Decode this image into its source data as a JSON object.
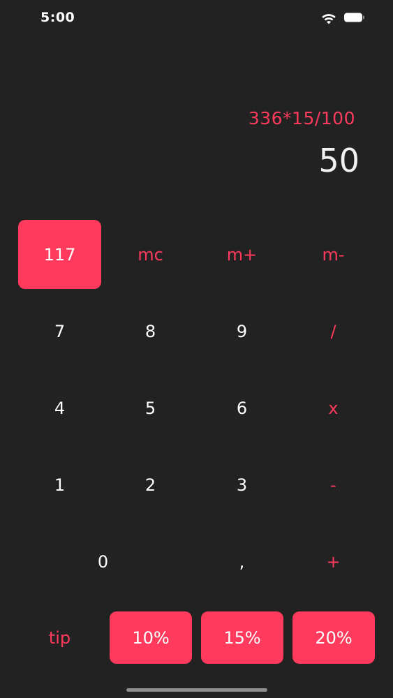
{
  "status": {
    "time": "5:00"
  },
  "display": {
    "expression": "336*15/100",
    "result": "50"
  },
  "memory_row": {
    "memory_value": "117",
    "mc": "mc",
    "m_plus": "m+",
    "m_minus": "m-"
  },
  "keypad": {
    "seven": "7",
    "eight": "8",
    "nine": "9",
    "divide": "/",
    "four": "4",
    "five": "5",
    "six": "6",
    "multiply": "x",
    "one": "1",
    "two": "2",
    "three": "3",
    "subtract": "-",
    "zero": "0",
    "comma": ",",
    "add": "+"
  },
  "tip_row": {
    "label": "tip",
    "ten": "10%",
    "fifteen": "15%",
    "twenty": "20%"
  },
  "colors": {
    "background": "#222223",
    "accent": "#ff3a5c"
  },
  "icons": {
    "wifi": "wifi-icon",
    "battery": "battery-icon"
  }
}
